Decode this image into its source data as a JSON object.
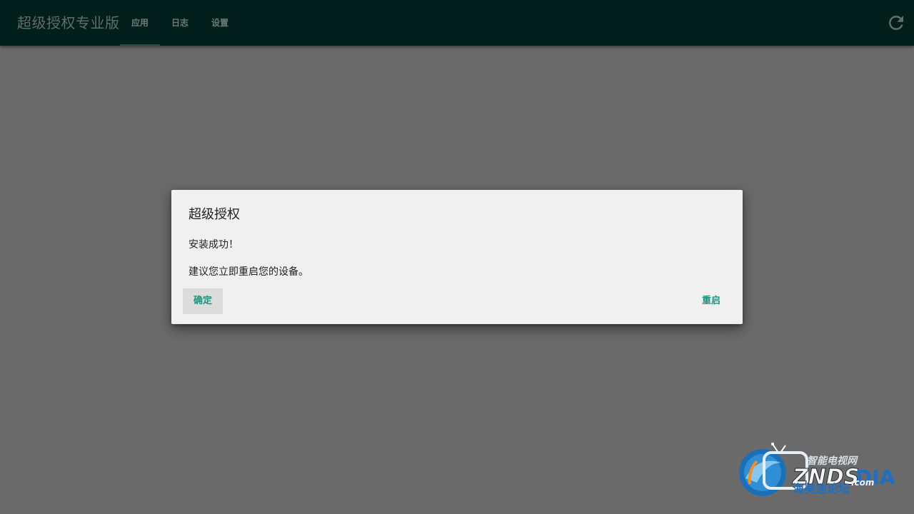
{
  "appbar": {
    "title": "超级授权专业版",
    "tabs": [
      {
        "label": "应用",
        "active": true
      },
      {
        "label": "日志",
        "active": false
      },
      {
        "label": "设置",
        "active": false
      }
    ],
    "refresh_icon": "refresh-icon"
  },
  "dialog": {
    "title": "超级授权",
    "message_line1": "安装成功！",
    "message_line2": "建议您立即重启您的设备。",
    "confirm_label": "确定",
    "restart_label": "重启"
  },
  "watermark": {
    "top_text": "智能电视网",
    "brand": "ZNDS",
    "suffix": ".com",
    "tail": "DIA",
    "bottom_text": "海美迪论坛"
  },
  "colors": {
    "appbar_bg": "#001e1a",
    "scrim": "#6a6a6a",
    "dialog_bg": "#f0f0f0",
    "accent": "#16967f"
  }
}
